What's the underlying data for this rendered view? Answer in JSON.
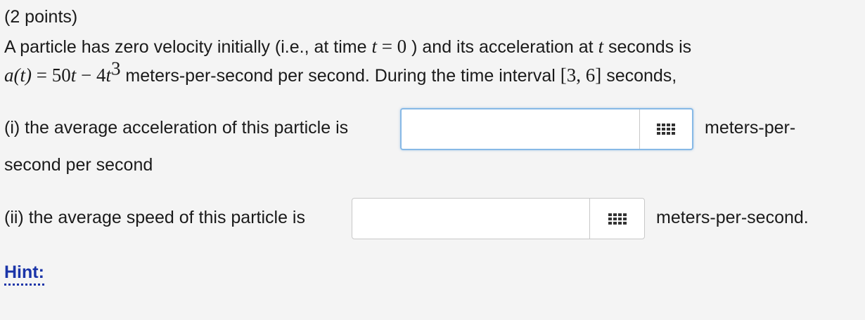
{
  "problem": {
    "points": "(2 points)",
    "line1": {
      "text_a": "A particle has zero velocity initially (i.e., at time ",
      "var_t": "t",
      "equals_zero": " = 0",
      "text_b": " ) and its acceleration at ",
      "var_t2": "t",
      "text_c": " seconds is"
    },
    "line2": {
      "a_t": "a",
      "paren_t": "(t)",
      "eq": " = 50",
      "t1": "t",
      "minus": " − 4",
      "t2": "t",
      "exp": "3",
      "text_a": " meters-per-second per second. During the time interval ",
      "interval": "[3, 6]",
      "text_b": " seconds,"
    }
  },
  "part1": {
    "label": "(i) the average acceleration of this particle is",
    "input_value": "",
    "unit_a": "meters-per-",
    "unit_b": "second per second"
  },
  "part2": {
    "label": "(ii) the average speed of this particle is",
    "input_value": "",
    "unit": "meters-per-second."
  },
  "hint": "Hint:",
  "icons": {
    "keypad": "keypad-grid-icon"
  },
  "colors": {
    "background": "#f4f4f4",
    "hint": "#1a34a8",
    "focus_border": "#87b9e6"
  }
}
